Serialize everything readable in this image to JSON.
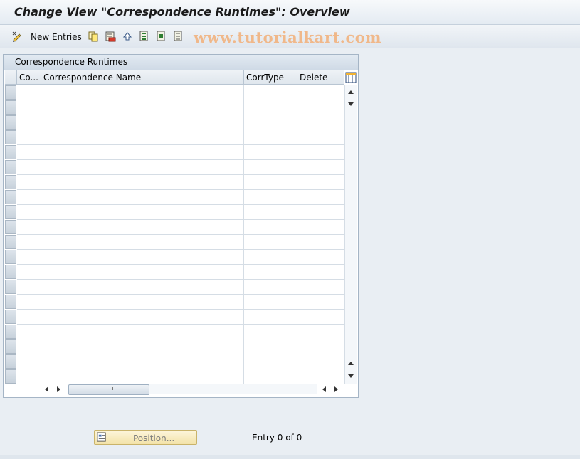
{
  "title": "Change View \"Correspondence Runtimes\": Overview",
  "toolbar": {
    "new_entries_label": "New Entries",
    "watermark": "www.tutorialkart.com"
  },
  "table": {
    "section_title": "Correspondence Runtimes",
    "columns": [
      "Co...",
      "Correspondence Name",
      "CorrType",
      "Delete"
    ],
    "row_count": 20
  },
  "footer": {
    "position_label": "Position...",
    "entry_text": "Entry 0 of 0"
  },
  "colors": {
    "background": "#e9eef3",
    "watermark": "#f0b88a",
    "position_button": "#f3e3a8"
  }
}
